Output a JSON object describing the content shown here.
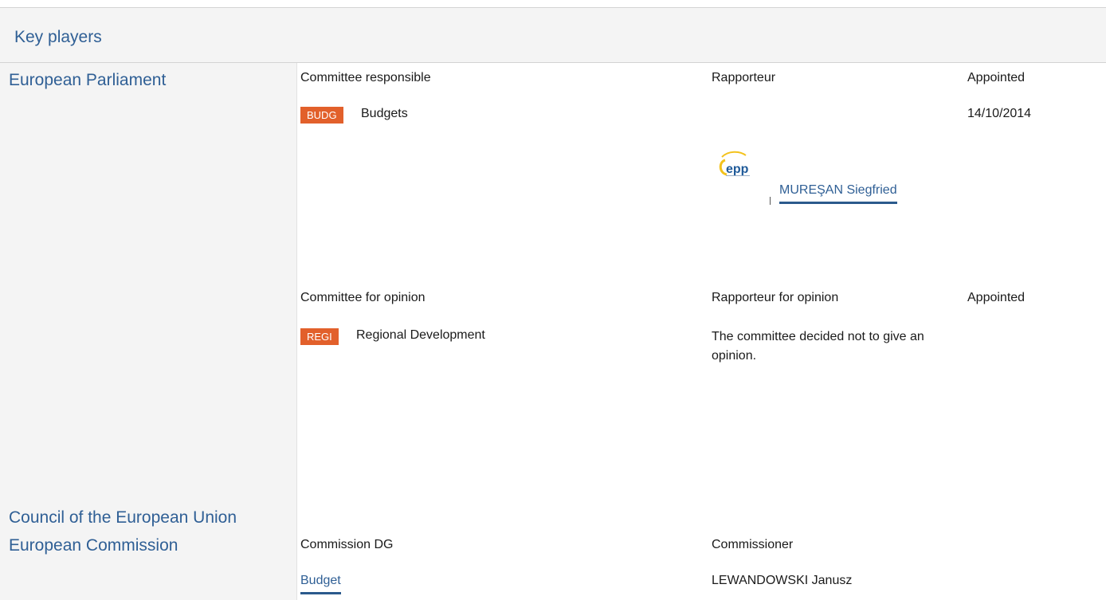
{
  "section": {
    "title": "Key players"
  },
  "institutions": {
    "parliament": "European Parliament",
    "council": "Council of the European Union",
    "commission": "European Commission"
  },
  "parliament": {
    "responsible": {
      "committee_header": "Committee responsible",
      "rapporteur_header": "Rapporteur",
      "appointed_header": "Appointed",
      "committee_code": "BUDG",
      "committee_name": "Budgets",
      "appointed_date": "14/10/2014",
      "rapporteur_name": "MUREŞAN Siegfried",
      "group_logo": "epp-logo",
      "group_logo_text": "epp"
    },
    "opinion": {
      "committee_header": "Committee for opinion",
      "rapporteur_header": "Rapporteur for opinion",
      "appointed_header": "Appointed",
      "committee_code": "REGI",
      "committee_name": "Regional Development",
      "note": "The committee decided not to give an opinion."
    }
  },
  "commission": {
    "dg_header": "Commission DG",
    "commissioner_header": "Commissioner",
    "dg_name": "Budget",
    "commissioner_name": "LEWANDOWSKI Janusz"
  },
  "colors": {
    "link_blue": "#2f5f95",
    "badge_orange": "#e2602b",
    "panel_grey": "#f4f4f4"
  }
}
